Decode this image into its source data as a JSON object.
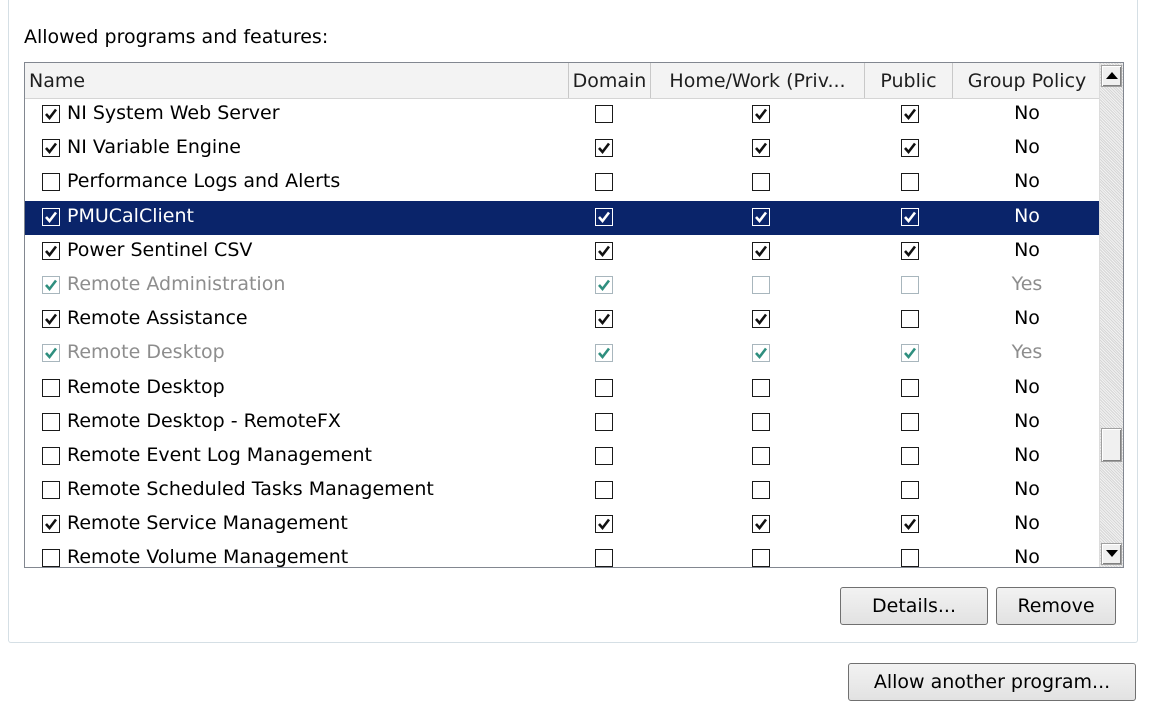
{
  "section_label": "Allowed programs and features:",
  "columns": {
    "name": "Name",
    "domain": "Domain",
    "home_work": "Home/Work (Priv...",
    "public": "Public",
    "group_policy": "Group Policy"
  },
  "rows": [
    {
      "checked": true,
      "name": "NI System Web Server",
      "domain": false,
      "home_work": true,
      "public": true,
      "group_policy": "No",
      "state": "normal"
    },
    {
      "checked": true,
      "name": "NI Variable Engine",
      "domain": true,
      "home_work": true,
      "public": true,
      "group_policy": "No",
      "state": "normal"
    },
    {
      "checked": false,
      "name": "Performance Logs and Alerts",
      "domain": false,
      "home_work": false,
      "public": false,
      "group_policy": "No",
      "state": "normal"
    },
    {
      "checked": true,
      "name": "PMUCalClient",
      "domain": true,
      "home_work": true,
      "public": true,
      "group_policy": "No",
      "state": "selected"
    },
    {
      "checked": true,
      "name": "Power Sentinel CSV",
      "domain": true,
      "home_work": true,
      "public": true,
      "group_policy": "No",
      "state": "normal"
    },
    {
      "checked": true,
      "name": "Remote Administration",
      "domain": true,
      "home_work": false,
      "public": false,
      "group_policy": "Yes",
      "state": "disabled"
    },
    {
      "checked": true,
      "name": "Remote Assistance",
      "domain": true,
      "home_work": true,
      "public": false,
      "group_policy": "No",
      "state": "normal"
    },
    {
      "checked": true,
      "name": "Remote Desktop",
      "domain": true,
      "home_work": true,
      "public": true,
      "group_policy": "Yes",
      "state": "disabled"
    },
    {
      "checked": false,
      "name": "Remote Desktop",
      "domain": false,
      "home_work": false,
      "public": false,
      "group_policy": "No",
      "state": "normal"
    },
    {
      "checked": false,
      "name": "Remote Desktop - RemoteFX",
      "domain": false,
      "home_work": false,
      "public": false,
      "group_policy": "No",
      "state": "normal"
    },
    {
      "checked": false,
      "name": "Remote Event Log Management",
      "domain": false,
      "home_work": false,
      "public": false,
      "group_policy": "No",
      "state": "normal"
    },
    {
      "checked": false,
      "name": "Remote Scheduled Tasks Management",
      "domain": false,
      "home_work": false,
      "public": false,
      "group_policy": "No",
      "state": "normal"
    },
    {
      "checked": true,
      "name": "Remote Service Management",
      "domain": true,
      "home_work": true,
      "public": true,
      "group_policy": "No",
      "state": "normal"
    },
    {
      "checked": false,
      "name": "Remote Volume Management",
      "domain": false,
      "home_work": false,
      "public": false,
      "group_policy": "No",
      "state": "normal"
    }
  ],
  "buttons": {
    "details": "Details...",
    "remove": "Remove",
    "allow_another": "Allow another program..."
  },
  "icons": {
    "scroll_up": "scroll-up-arrow-icon",
    "scroll_down": "scroll-down-arrow-icon",
    "check": "checkmark-icon"
  }
}
